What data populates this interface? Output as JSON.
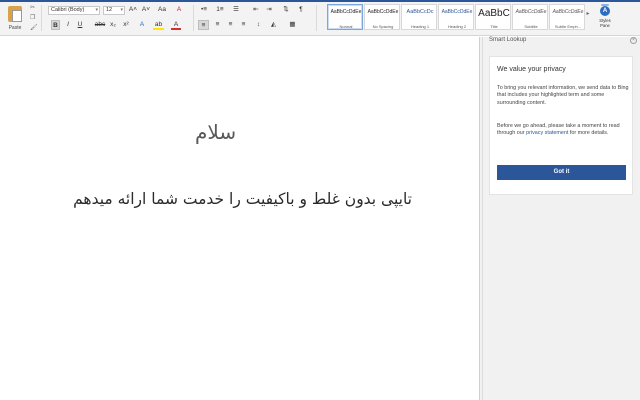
{
  "ribbon": {
    "paste_label": "Paste",
    "font_name": "Calibri (Body)",
    "font_size": "12",
    "buttons": {
      "grow_font": "A˄",
      "shrink_font": "A˅",
      "change_case": "Aa",
      "clear_format": "A",
      "bold": "B",
      "italic": "I",
      "underline": "U",
      "strikethrough": "abc",
      "subscript": "x₂",
      "superscript": "x²",
      "text_effects": "A",
      "highlight": "ab",
      "font_color": "A",
      "bullets": "•≡",
      "numbering": "1≡",
      "multilevel": "☰",
      "decrease_indent": "⇤",
      "increase_indent": "⇥",
      "sort": "⇅",
      "show_marks": "¶",
      "align_left": "≡",
      "align_center": "≡",
      "align_right": "≡",
      "justify": "≡",
      "line_spacing": "↕",
      "shading": "◭",
      "borders": "▦"
    },
    "styles": [
      {
        "sample": "AaBbCcDdEe",
        "name": "Normal"
      },
      {
        "sample": "AaBbCcDdEe",
        "name": "No Spacing"
      },
      {
        "sample": "AaBbCcDc",
        "name": "Heading 1"
      },
      {
        "sample": "AaBbCcDdEe",
        "name": "Heading 2"
      },
      {
        "sample": "AaBbC",
        "name": "Title"
      },
      {
        "sample": "AaBbCcDdEe",
        "name": "Subtitle"
      },
      {
        "sample": "AaBbCcDdEe",
        "name": "Subtle Emph..."
      }
    ],
    "styles_pane_label": "Styles Pane"
  },
  "document": {
    "heading": "سلام",
    "body": "تایپی بدون غلط و باکیفیت را خدمت شما ارائه میدهم"
  },
  "pane": {
    "title": "Smart Lookup",
    "card": {
      "heading": "We value your privacy",
      "paragraph1": "To bring you relevant information, we send data to Bing that includes your highlighted term and some surrounding content.",
      "paragraph2_before": "Before we go ahead, please take a moment to read through our ",
      "paragraph2_link": "privacy statement",
      "paragraph2_after": " for more details.",
      "button": "Got it"
    }
  },
  "colors": {
    "accent": "#2b579a",
    "highlight_color": "#ffe600",
    "font_color": "#d0312d"
  }
}
